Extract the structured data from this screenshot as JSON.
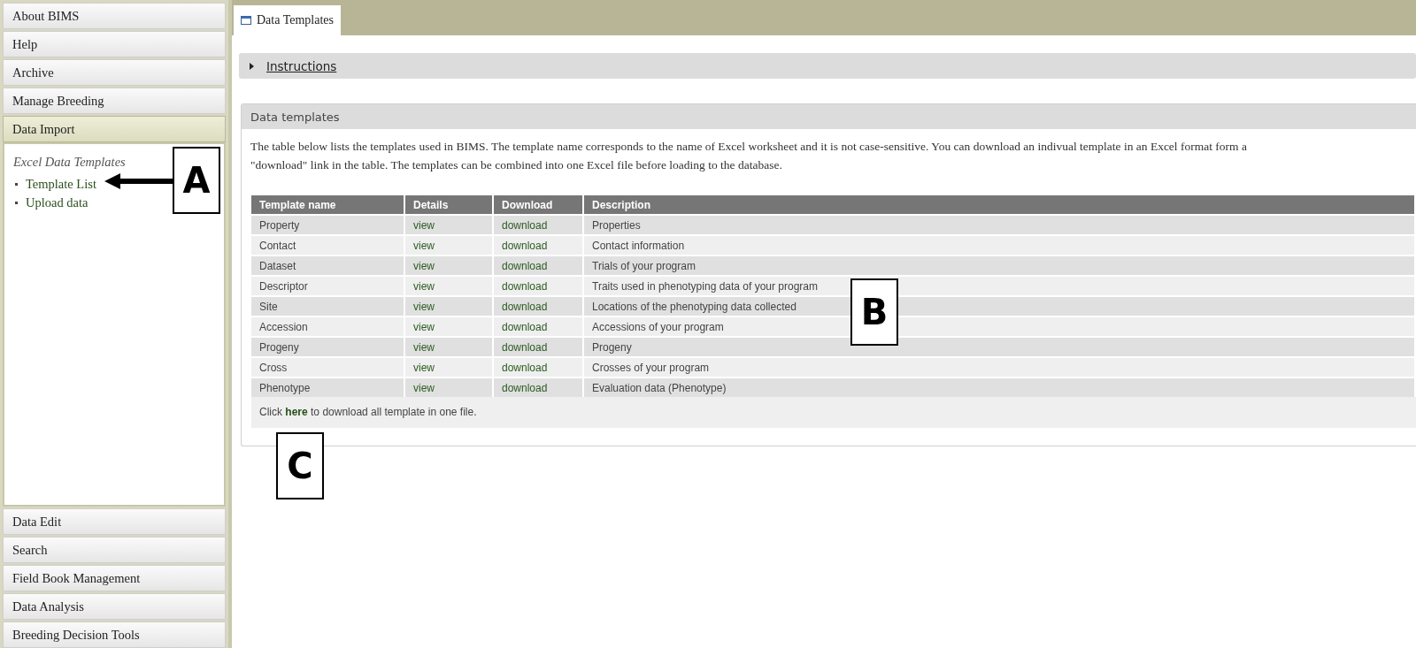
{
  "sidebar": {
    "items": [
      {
        "label": "About BIMS",
        "expanded": false
      },
      {
        "label": "Help",
        "expanded": false
      },
      {
        "label": "Archive",
        "expanded": false
      },
      {
        "label": "Manage Breeding",
        "expanded": false
      },
      {
        "label": "Data Import",
        "expanded": true,
        "section_title": "Excel Data Templates",
        "links": [
          "Template List",
          "Upload data"
        ]
      },
      {
        "label": "Data Edit",
        "expanded": false
      },
      {
        "label": "Search",
        "expanded": false
      },
      {
        "label": "Field Book Management",
        "expanded": false
      },
      {
        "label": "Data Analysis",
        "expanded": false
      },
      {
        "label": "Breeding Decision Tools",
        "expanded": false
      }
    ]
  },
  "tabs": [
    {
      "label": "Data Templates",
      "selected": true
    }
  ],
  "instructions": {
    "label": "Instructions",
    "expanded": false
  },
  "panel": {
    "title": "Data templates",
    "text_lines": [
      "The table below lists the templates used in BIMS. The template name corresponds to the name of Excel worksheet and it is not case-sensitive. You can download an indivual template in an Excel format form a",
      "\"download\" link in the table. The templates can be combined into one Excel file before loading to the database."
    ],
    "table": {
      "columns": [
        "Template name",
        "Details",
        "Download",
        "Description"
      ],
      "rows": [
        [
          "Property",
          "view",
          "download",
          "Properties"
        ],
        [
          "Contact",
          "view",
          "download",
          "Contact information"
        ],
        [
          "Dataset",
          "view",
          "download",
          "Trials of your program"
        ],
        [
          "Descriptor",
          "view",
          "download",
          "Traits used in phenotyping data of your program"
        ],
        [
          "Site",
          "view",
          "download",
          "Locations of the phenotyping data collected"
        ],
        [
          "Accession",
          "view",
          "download",
          "Accessions of your program"
        ],
        [
          "Progeny",
          "view",
          "download",
          "Progeny"
        ],
        [
          "Cross",
          "view",
          "download",
          "Crosses of your program"
        ],
        [
          "Phenotype",
          "view",
          "download",
          "Evaluation data (Phenotype)"
        ]
      ]
    },
    "footer": "Click **here** to download all template in one file."
  },
  "annotations": [
    {
      "label": "A",
      "kind": "arrow"
    },
    {
      "label": "B",
      "kind": "box"
    },
    {
      "label": "C",
      "kind": "box"
    }
  ]
}
